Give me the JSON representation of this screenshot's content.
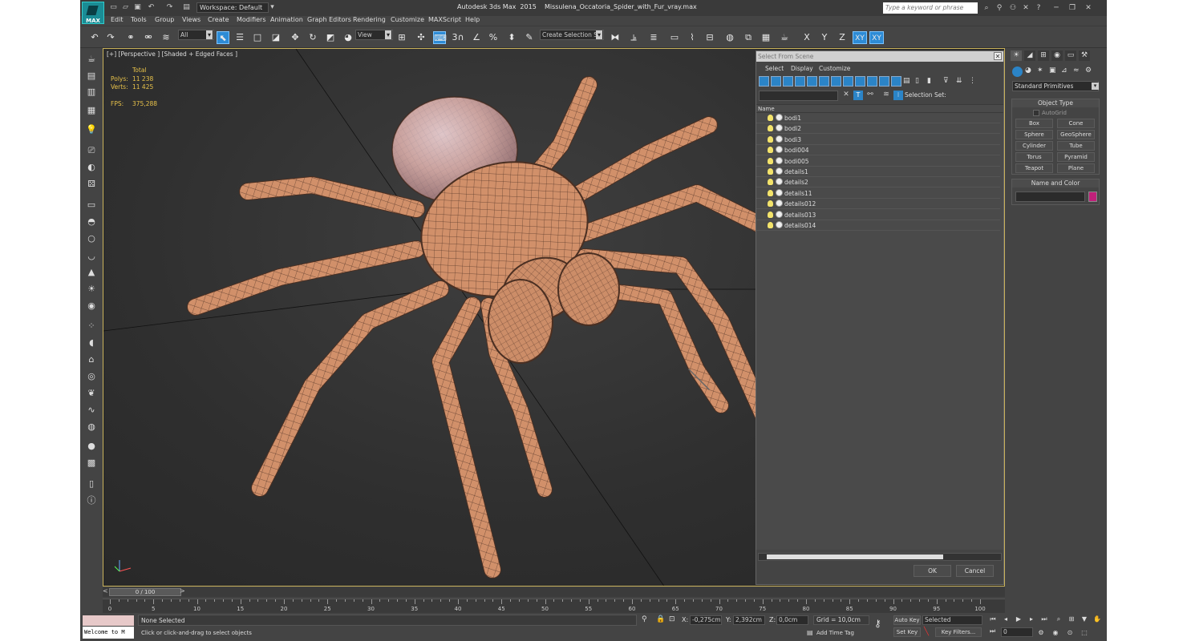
{
  "titlebar": {
    "workspace": "Workspace: Default",
    "app_title": "Autodesk 3ds Max  2015    Missulena_Occatoria_Spider_with_Fur_vray.max",
    "search_placeholder": "Type a keyword or phrase",
    "logo_text": "MAX"
  },
  "menus": [
    "Edit",
    "Tools",
    "Group",
    "Views",
    "Create",
    "Modifiers",
    "Animation",
    "Graph Editors",
    "Rendering",
    "Customize",
    "MAXScript",
    "Help"
  ],
  "toolbar": {
    "filter": "All",
    "refcoord": "View",
    "snap_label": "3",
    "selection_set": "Create Selection Se",
    "axis_x": "X",
    "axis_y": "Y",
    "axis_z": "Z",
    "axis_xy": "XY",
    "axis_xy2": "XY"
  },
  "viewport": {
    "label": "[+] [Perspective ] [Shaded + Edged Faces ]",
    "stats_total": "Total",
    "polys_label": "Polys:",
    "polys_value": "11 238",
    "verts_label": "Verts:",
    "verts_value": "11 425",
    "fps_label": "FPS:",
    "fps_value": "375,288"
  },
  "dialog": {
    "title": "Select From Scene",
    "menu": [
      "Select",
      "Display",
      "Customize"
    ],
    "selection_set_label": "Selection Set:",
    "column_name": "Name",
    "objects": [
      "bodi1",
      "bodi2",
      "bodi3",
      "bodi004",
      "bodi005",
      "details1",
      "details2",
      "details11",
      "details012",
      "details013",
      "details014"
    ],
    "ok_label": "OK",
    "cancel_label": "Cancel"
  },
  "command_panel": {
    "category": "Standard Primitives",
    "object_type_header": "Object Type",
    "autogrid": "AutoGrid",
    "primitives": [
      "Box",
      "Cone",
      "Sphere",
      "GeoSphere",
      "Cylinder",
      "Tube",
      "Torus",
      "Pyramid",
      "Teapot",
      "Plane"
    ],
    "name_color_header": "Name and Color",
    "object_color": "#c0207a"
  },
  "timeline": {
    "slider_label": "0 / 100",
    "ticks": [
      "0",
      "5",
      "10",
      "15",
      "20",
      "25",
      "30",
      "35",
      "40",
      "45",
      "50",
      "55",
      "60",
      "65",
      "70",
      "75",
      "80",
      "85",
      "90",
      "95",
      "100"
    ]
  },
  "status": {
    "maxscript_text": "Welcome to M",
    "selection": "None Selected",
    "prompt": "Click or click-and-drag to select objects",
    "x_label": "X:",
    "x_value": "-0,275cm",
    "y_label": "Y:",
    "y_value": "2,392cm",
    "z_label": "Z:",
    "z_value": "0,0cm",
    "grid": "Grid = 10,0cm",
    "add_time_tag": "Add Time Tag",
    "auto_key": "Auto Key",
    "selected": "Selected",
    "set_key": "Set Key",
    "key_filters": "Key Filters...",
    "frame": "0"
  }
}
